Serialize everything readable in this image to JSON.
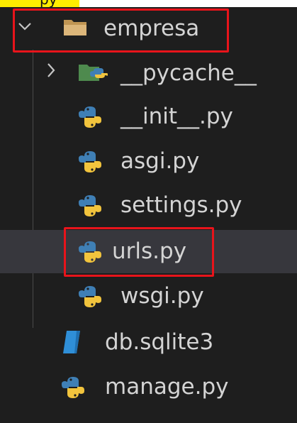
{
  "top_strip": {
    "text": "py",
    "highlight_color": "#ffee00"
  },
  "explorer": {
    "colors": {
      "background": "#1e1e1e",
      "selected_row": "#37373d",
      "text": "#d4d4d4",
      "annotation": "#e8141b"
    },
    "items": [
      {
        "label": "empresa",
        "icon": "folder-open-icon",
        "expanded": true
      },
      {
        "label": "__pycache__",
        "icon": "folder-python-icon",
        "expanded": false
      },
      {
        "label": "__init__.py",
        "icon": "python-icon"
      },
      {
        "label": "asgi.py",
        "icon": "python-icon"
      },
      {
        "label": "settings.py",
        "icon": "python-icon"
      },
      {
        "label": "urls.py",
        "icon": "python-icon",
        "selected": true
      },
      {
        "label": "wsgi.py",
        "icon": "python-icon"
      },
      {
        "label": "db.sqlite3",
        "icon": "database-file-icon"
      },
      {
        "label": "manage.py",
        "icon": "python-icon"
      }
    ]
  }
}
